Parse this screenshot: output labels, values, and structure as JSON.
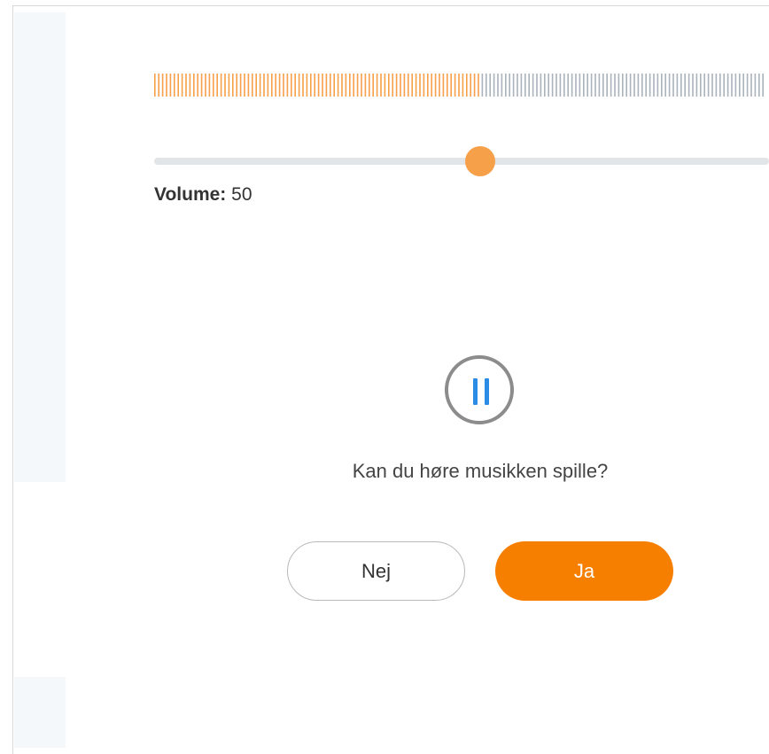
{
  "level_meter": {
    "active_fraction": 0.53,
    "active_color": "#f7a04a",
    "inactive_color": "#aab2bb"
  },
  "volume": {
    "label": "Volume:",
    "value": "50",
    "fraction": 0.53,
    "thumb_color": "#f7a04a",
    "track_color": "#e2e5e8"
  },
  "player": {
    "state_icon": "pause-icon",
    "icon_color": "#2b8ce6"
  },
  "prompt": {
    "question": "Kan du høre musikken spille?"
  },
  "buttons": {
    "no_label": "Nej",
    "yes_label": "Ja",
    "yes_color": "#f77f00"
  }
}
